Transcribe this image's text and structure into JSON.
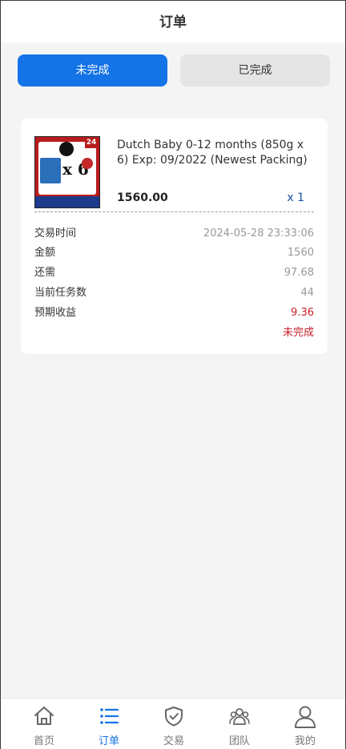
{
  "header": {
    "title": "订单"
  },
  "tabs": [
    {
      "label": "未完成",
      "active": true
    },
    {
      "label": "已完成",
      "active": false
    }
  ],
  "order": {
    "product_title": "Dutch Baby 0-12 months (850g x 6) Exp: 09/2022 (Newest Packing)",
    "thumb_text": "x 6",
    "thumb_tag": "24",
    "price": "1560.00",
    "quantity": "x 1",
    "details": [
      {
        "label": "交易时间",
        "value": "2024-05-28 23:33:06"
      },
      {
        "label": "金额",
        "value": "1560"
      },
      {
        "label": "还需",
        "value": "97.68"
      },
      {
        "label": "当前任务数",
        "value": "44"
      },
      {
        "label": "预期收益",
        "value": "9.36"
      }
    ],
    "status": "未完成"
  },
  "nav": [
    {
      "label": "首页",
      "icon": "home-icon",
      "active": false
    },
    {
      "label": "订单",
      "icon": "list-icon",
      "active": true
    },
    {
      "label": "交易",
      "icon": "shield-check-icon",
      "active": false
    },
    {
      "label": "团队",
      "icon": "team-icon",
      "active": false
    },
    {
      "label": "我的",
      "icon": "user-icon",
      "active": false
    }
  ],
  "colors": {
    "accent": "#1473e6",
    "status_red": "#c81e2a",
    "muted": "#999999"
  }
}
